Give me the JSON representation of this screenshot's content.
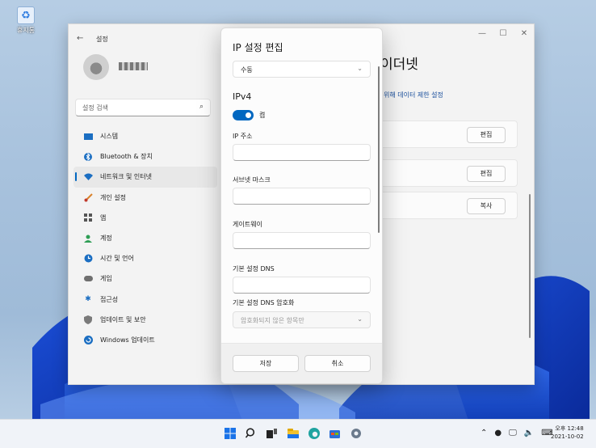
{
  "desktop": {
    "recycle_bin_label": "휴지통"
  },
  "settings": {
    "window_title": "설정",
    "search_placeholder": "설정 검색",
    "nav_items": [
      {
        "label": "시스템",
        "icon": "monitor-icon"
      },
      {
        "label": "Bluetooth & 장치",
        "icon": "bluetooth-icon"
      },
      {
        "label": "네트워크 및 인터넷",
        "icon": "wifi-icon",
        "active": true
      },
      {
        "label": "개인 설정",
        "icon": "brush-icon"
      },
      {
        "label": "앱",
        "icon": "apps-icon"
      },
      {
        "label": "계정",
        "icon": "person-icon"
      },
      {
        "label": "시간 및 언어",
        "icon": "globe-clock-icon"
      },
      {
        "label": "게임",
        "icon": "gamepad-icon"
      },
      {
        "label": "접근성",
        "icon": "accessibility-icon"
      },
      {
        "label": "업데이트 및 보안",
        "icon": "shield-icon"
      },
      {
        "label": "Windows 업데이트",
        "icon": "refresh-icon"
      }
    ],
    "page_title_partial": "이더넷",
    "data_limit_link": "위해 데이터 제한 설정",
    "row_buttons": [
      "편집",
      "편집",
      "복사"
    ]
  },
  "dialog": {
    "title": "IP 설정 편집",
    "mode_value": "수동",
    "section_title": "IPv4",
    "toggle_label": "켬",
    "toggle_on": true,
    "fields": [
      {
        "label": "IP 주소",
        "value": ""
      },
      {
        "label": "서브넷 마스크",
        "value": ""
      },
      {
        "label": "게이트웨이",
        "value": ""
      },
      {
        "label": "기본 설정 DNS",
        "value": ""
      }
    ],
    "dns_encryption_label": "기본 설정 DNS 암호화",
    "dns_encryption_value": "암호화되지 않은 항목만",
    "save_label": "저장",
    "cancel_label": "취소"
  },
  "taskbar": {
    "clock_time": "오후 12:48",
    "clock_date": "2021-10-02"
  },
  "colors": {
    "accent": "#0067c0",
    "link": "#1a4f9c"
  }
}
